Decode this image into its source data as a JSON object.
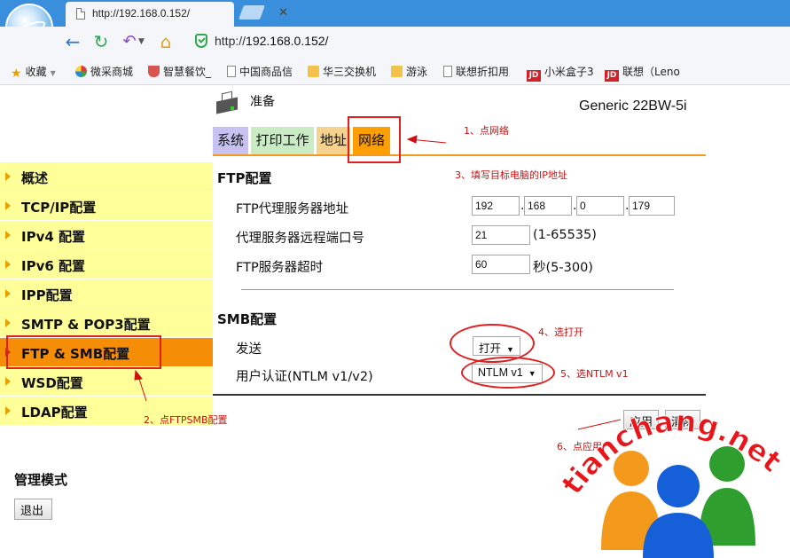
{
  "browser": {
    "tab_title": "http://192.168.0.152/",
    "tab_close": "✕",
    "url_prefix": "http://",
    "url_domain": "192.168.0.152/",
    "bookmarks": [
      {
        "label": "收藏",
        "icon": "star-icon"
      },
      {
        "label": "微采商城",
        "icon": "colorful-circle-icon"
      },
      {
        "label": "智慧餐饮_",
        "icon": "bowl-icon"
      },
      {
        "label": "中国商品信",
        "icon": "page-icon"
      },
      {
        "label": "华三交换机",
        "icon": "folder-icon"
      },
      {
        "label": "游泳",
        "icon": "folder-icon"
      },
      {
        "label": "联想折扣用",
        "icon": "page-icon"
      },
      {
        "label": "小米盒子3",
        "icon": "jd-icon"
      },
      {
        "label": "联想（Leno",
        "icon": "jd-icon"
      }
    ],
    "jd_badge": "JD"
  },
  "printer": {
    "status": "准备",
    "model": "Generic 22BW-5i"
  },
  "top_tabs": [
    {
      "label": "系统"
    },
    {
      "label": "打印工作"
    },
    {
      "label": "地址"
    },
    {
      "label": "网络",
      "active": true
    }
  ],
  "left_menu": [
    {
      "label": "概述"
    },
    {
      "label": "TCP/IP配置"
    },
    {
      "label": "IPv4 配置"
    },
    {
      "label": "IPv6 配置"
    },
    {
      "label": "IPP配置"
    },
    {
      "label": "SMTP & POP3配置"
    },
    {
      "label": "FTP & SMB配置",
      "active": true
    },
    {
      "label": "WSD配置"
    },
    {
      "label": "LDAP配置"
    }
  ],
  "ftp": {
    "section_title": "FTP配置",
    "proxy_label": "FTP代理服务器地址",
    "ip": [
      "192",
      "168",
      "0",
      "179"
    ],
    "port_label": "代理服务器远程端口号",
    "port_value": "21",
    "port_range": "(1-65535)",
    "timeout_label": "FTP服务器超时",
    "timeout_value": "60",
    "timeout_range": "秒(5-300)"
  },
  "smb": {
    "section_title": "SMB配置",
    "send_label": "发送",
    "send_value": "打开",
    "auth_label": "用户认证(NTLM v1/v2)",
    "auth_value": "NTLM v1"
  },
  "buttons": {
    "apply": "应用",
    "clear": "清除",
    "logout": "退出"
  },
  "admin_title": "管理模式",
  "annotations": {
    "a1": "1、点网络",
    "a2": "2、点FTPSMB配置",
    "a3": "3、填写目标电脑的IP地址",
    "a4": "4、选打开",
    "a5": "5、选NTLM v1",
    "a6": "6、点应用"
  },
  "watermark": {
    "text": "tianchang.net",
    "colors": {
      "text": "#e8161b",
      "orange": "#f39a1d",
      "blue": "#1560d8",
      "green": "#2e9e2e"
    }
  },
  "colors": {
    "menu_bg": "#ffff9a",
    "menu_active": "#f68d07",
    "annotation": "#cc1111"
  }
}
